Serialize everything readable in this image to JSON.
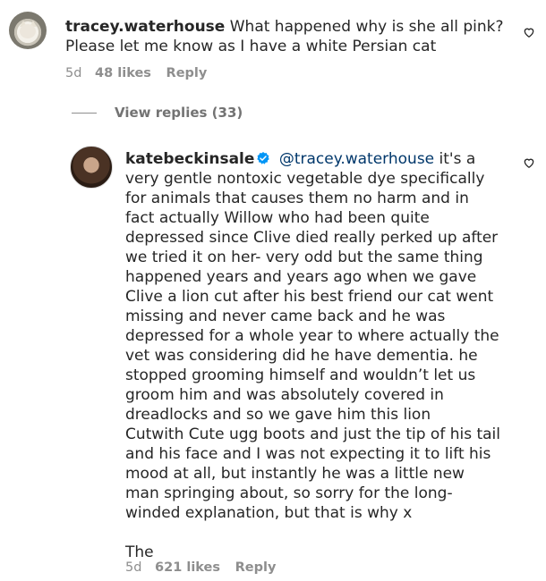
{
  "comment1": {
    "username": "tracey.waterhouse",
    "text": "What happened why is she all pink? Please let me know as I have a white Persian cat",
    "time": "5d",
    "likes": "48 likes",
    "reply": "Reply",
    "avatar_icon": "persian-cat-avatar",
    "heart_icon": "heart-outline-icon"
  },
  "view_replies": {
    "label": "View replies (33)"
  },
  "comment2": {
    "username": "katebeckinsale",
    "verified_icon": "verified-badge-icon",
    "mention": "@tracey.waterhouse",
    "text_p1": "it's a very gentle nontoxic vegetable dye specifically for animals that causes them no harm and in fact actually Willow who had been quite depressed since Clive died really perked up after we tried it on her- very odd but the same thing happened years and years ago when we gave Clive a lion cut after his best friend our cat went missing and never came back and he was depressed for a whole year to where actually the vet was considering did he have dementia. he stopped grooming himself and wouldn’t let us groom him and was absolutely covered in dreadlocks and so we gave him this lion",
    "text_p2": "Cutwith Cute ugg boots and just the tip of his tail and his face and I was not expecting it to lift his mood at all, but instantly he was a little new man springing about, so sorry for the long-winded explanation, but that is why x",
    "text_p3": "The",
    "time": "5d",
    "likes": "621 likes",
    "reply": "Reply",
    "avatar_icon": "profile-photo-avatar",
    "heart_icon": "heart-outline-icon"
  },
  "colors": {
    "mention": "#00376b",
    "verified": "#0095f6",
    "meta": "#8e8e8e"
  }
}
